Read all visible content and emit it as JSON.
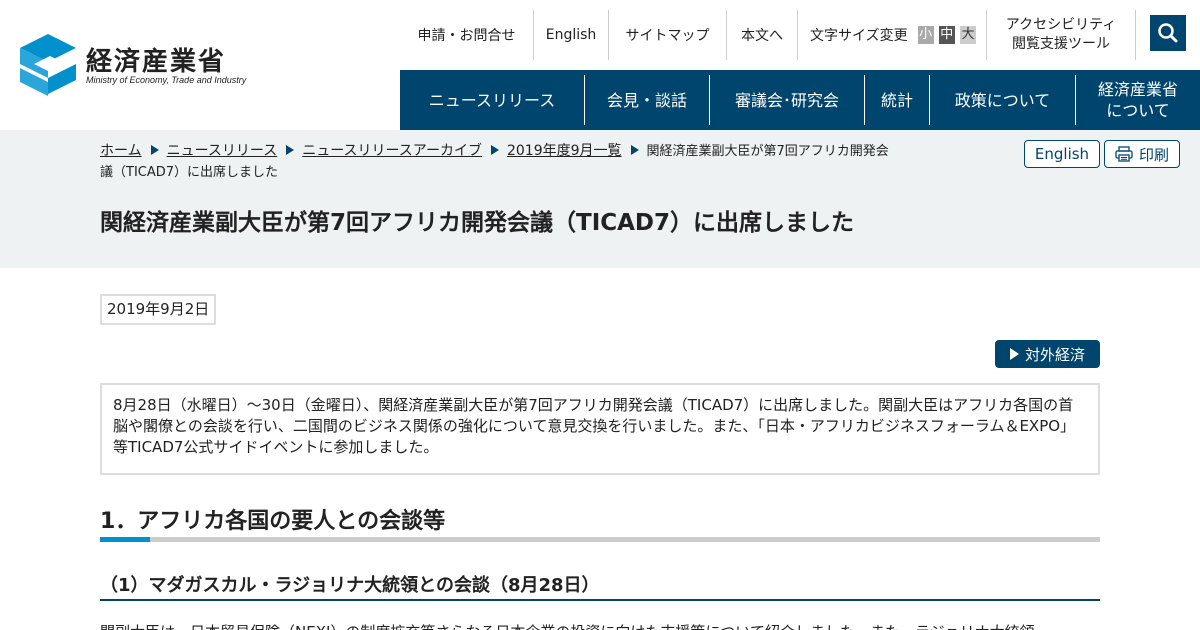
{
  "logo": {
    "name_ja": "経済産業省",
    "name_en": "Ministry of Economy, Trade and Industry"
  },
  "utility_nav": {
    "items": [
      "申請・お問合せ",
      "English",
      "サイトマップ",
      "本文へ"
    ],
    "font_size_label": "文字サイズ変更",
    "font_sizes": [
      "小",
      "中",
      "大"
    ],
    "accessibility_line1": "アクセシビリティ",
    "accessibility_line2": "閲覧支援ツール",
    "search_icon": "search-icon"
  },
  "global_nav": {
    "items": [
      "ニュースリリース",
      "会見・談話",
      "審議会･研究会",
      "統計",
      "政策について",
      "経済産業省について"
    ],
    "last_line1": "経済産業省",
    "last_line2": "について"
  },
  "breadcrumb": {
    "links": [
      "ホーム",
      "ニュースリリース",
      "ニュースリリースアーカイブ",
      "2019年度9月一覧"
    ],
    "current": "関経済産業副大臣が第7回アフリカ開発会議（TICAD7）に出席しました"
  },
  "page_actions": {
    "english": "English",
    "print": "印刷",
    "print_icon": "printer-icon"
  },
  "page_title": "関経済産業副大臣が第7回アフリカ開発会議（TICAD7）に出席しました",
  "date": "2019年9月2日",
  "category_tag": "対外経済",
  "summary": "8月28日（水曜日）～30日（金曜日）、関経済産業副大臣が第7回アフリカ開発会議（TICAD7）に出席しました。関副大臣はアフリカ各国の首脳や閣僚との会談を行い、二国間のビジネス関係の強化について意見交換を行いました。また、「日本・アフリカビジネスフォーラム＆EXPO」等TICAD7公式サイドイベントに参加しました。",
  "section1": {
    "heading": "1．アフリカ各国の要人との会談等",
    "sub1_heading": "（1）マダガスカル・ラジョリナ大統領との会談（8月28日）",
    "sub1_text": "関副大臣は、日本貿易保険（NEXI）の制度拡充等さらなる日本企業の投資に向けた支援策について紹介しました。また、ラジョリナ大統領"
  },
  "colors": {
    "brand": "#00456e",
    "accent": "#0091cc",
    "band": "#eef2f2"
  }
}
